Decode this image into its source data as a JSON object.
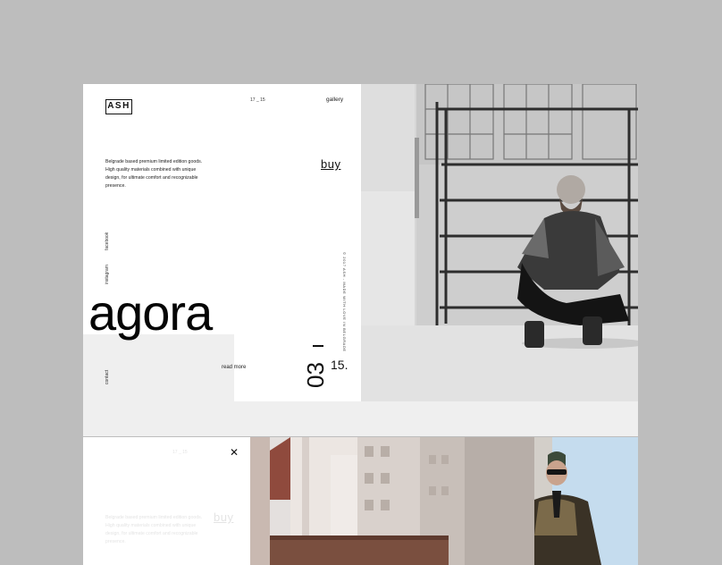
{
  "card1": {
    "logo": "ASH",
    "index": "17 _ 15",
    "nav_gallery": "gallery",
    "description": "Belgrade based premium limited edition goods. High quality materials combined with unique design, for ultimate comfort and recognizable presence.",
    "buy_label": "buy",
    "social": {
      "facebook": "facebook",
      "instagram": "instagram",
      "contact": "contact"
    },
    "product_name": "agora",
    "read_more": "read more",
    "vertical_caption": "© 2017 ASH - MADE WITH LOVE IN BELGRADE",
    "slide_current": "03",
    "slide_total": "15."
  },
  "card2": {
    "close_icon": "close-icon",
    "index": "17 _ 15",
    "description": "Belgrade based premium limited edition goods. High quality materials combined with unique design, for ultimate comfort and recognizable presence.",
    "buy_label": "buy"
  },
  "colors": {
    "background": "#bdbdbd",
    "card_gray": "#efefef",
    "text": "#111111"
  }
}
